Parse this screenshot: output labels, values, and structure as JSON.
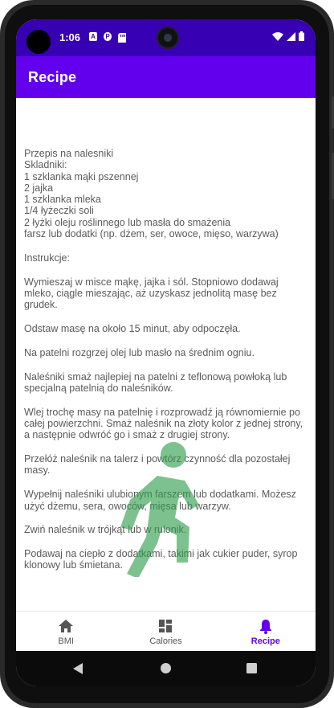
{
  "status_bar": {
    "time": "1:06",
    "icons": [
      "a-icon",
      "p-icon",
      "sd-card-icon",
      "wifi-icon",
      "signal-icon",
      "battery-icon"
    ],
    "icon_labels": {
      "a": "A",
      "p": "P"
    }
  },
  "app_bar": {
    "title": "Recipe"
  },
  "recipe": {
    "title_line": "Przepis na nalesniki",
    "ingredients_heading": "Skladniki:",
    "ingredients": [
      "1 szklanka mąki pszennej",
      "2 jajka",
      "1 szklanka mleka",
      "1/4 łyżeczki soli",
      "2 łyżki oleju roślinnego lub masła do smażenia",
      "farsz lub dodatki (np. dżem, ser, owoce, mięso, warzywa)"
    ],
    "instructions_heading": "Instrukcje:",
    "steps": [
      "Wymieszaj w misce mąkę, jajka i sól. Stopniowo dodawaj mleko, ciągle mieszając, aż uzyskasz jednolitą masę bez grudek.",
      "Odstaw masę na około 15 minut, aby odpoczęła.",
      "Na patelni rozgrzej olej lub masło na średnim ogniu.",
      "Naleśniki smaż najlepiej na patelni z teflonową powłoką lub specjalną patelnią do naleśników.",
      "Wlej trochę masy na patelnię i rozprowadź ją równomiernie po całej powierzchni. Smaż naleśnik na złoty kolor z jednej strony, a następnie odwróć go i smaż z drugiej strony.",
      "Przełóż naleśnik na talerz i powtórz czynność dla pozostałej masy.",
      "Wypełnij naleśniki ulubionym farszem lub dodatkami. Możesz użyć dżemu, sera, owoców, mięsa lub warzyw.",
      "Zwiń naleśnik w trójkąt lub w rulonik.",
      "Podawaj na ciepło z dodatkami, takimi jak cukier puder, syrop klonowy lub śmietana."
    ]
  },
  "bottom_nav": {
    "items": [
      {
        "label": "BMI",
        "icon": "home-icon",
        "active": false
      },
      {
        "label": "Calories",
        "icon": "dashboard-icon",
        "active": false
      },
      {
        "label": "Recipe",
        "icon": "bell-icon",
        "active": true
      }
    ]
  },
  "colors": {
    "status_bar": "#3700b3",
    "app_bar": "#6200ee",
    "accent": "#6200ee",
    "overlay_figure": "#2e9e4a"
  }
}
